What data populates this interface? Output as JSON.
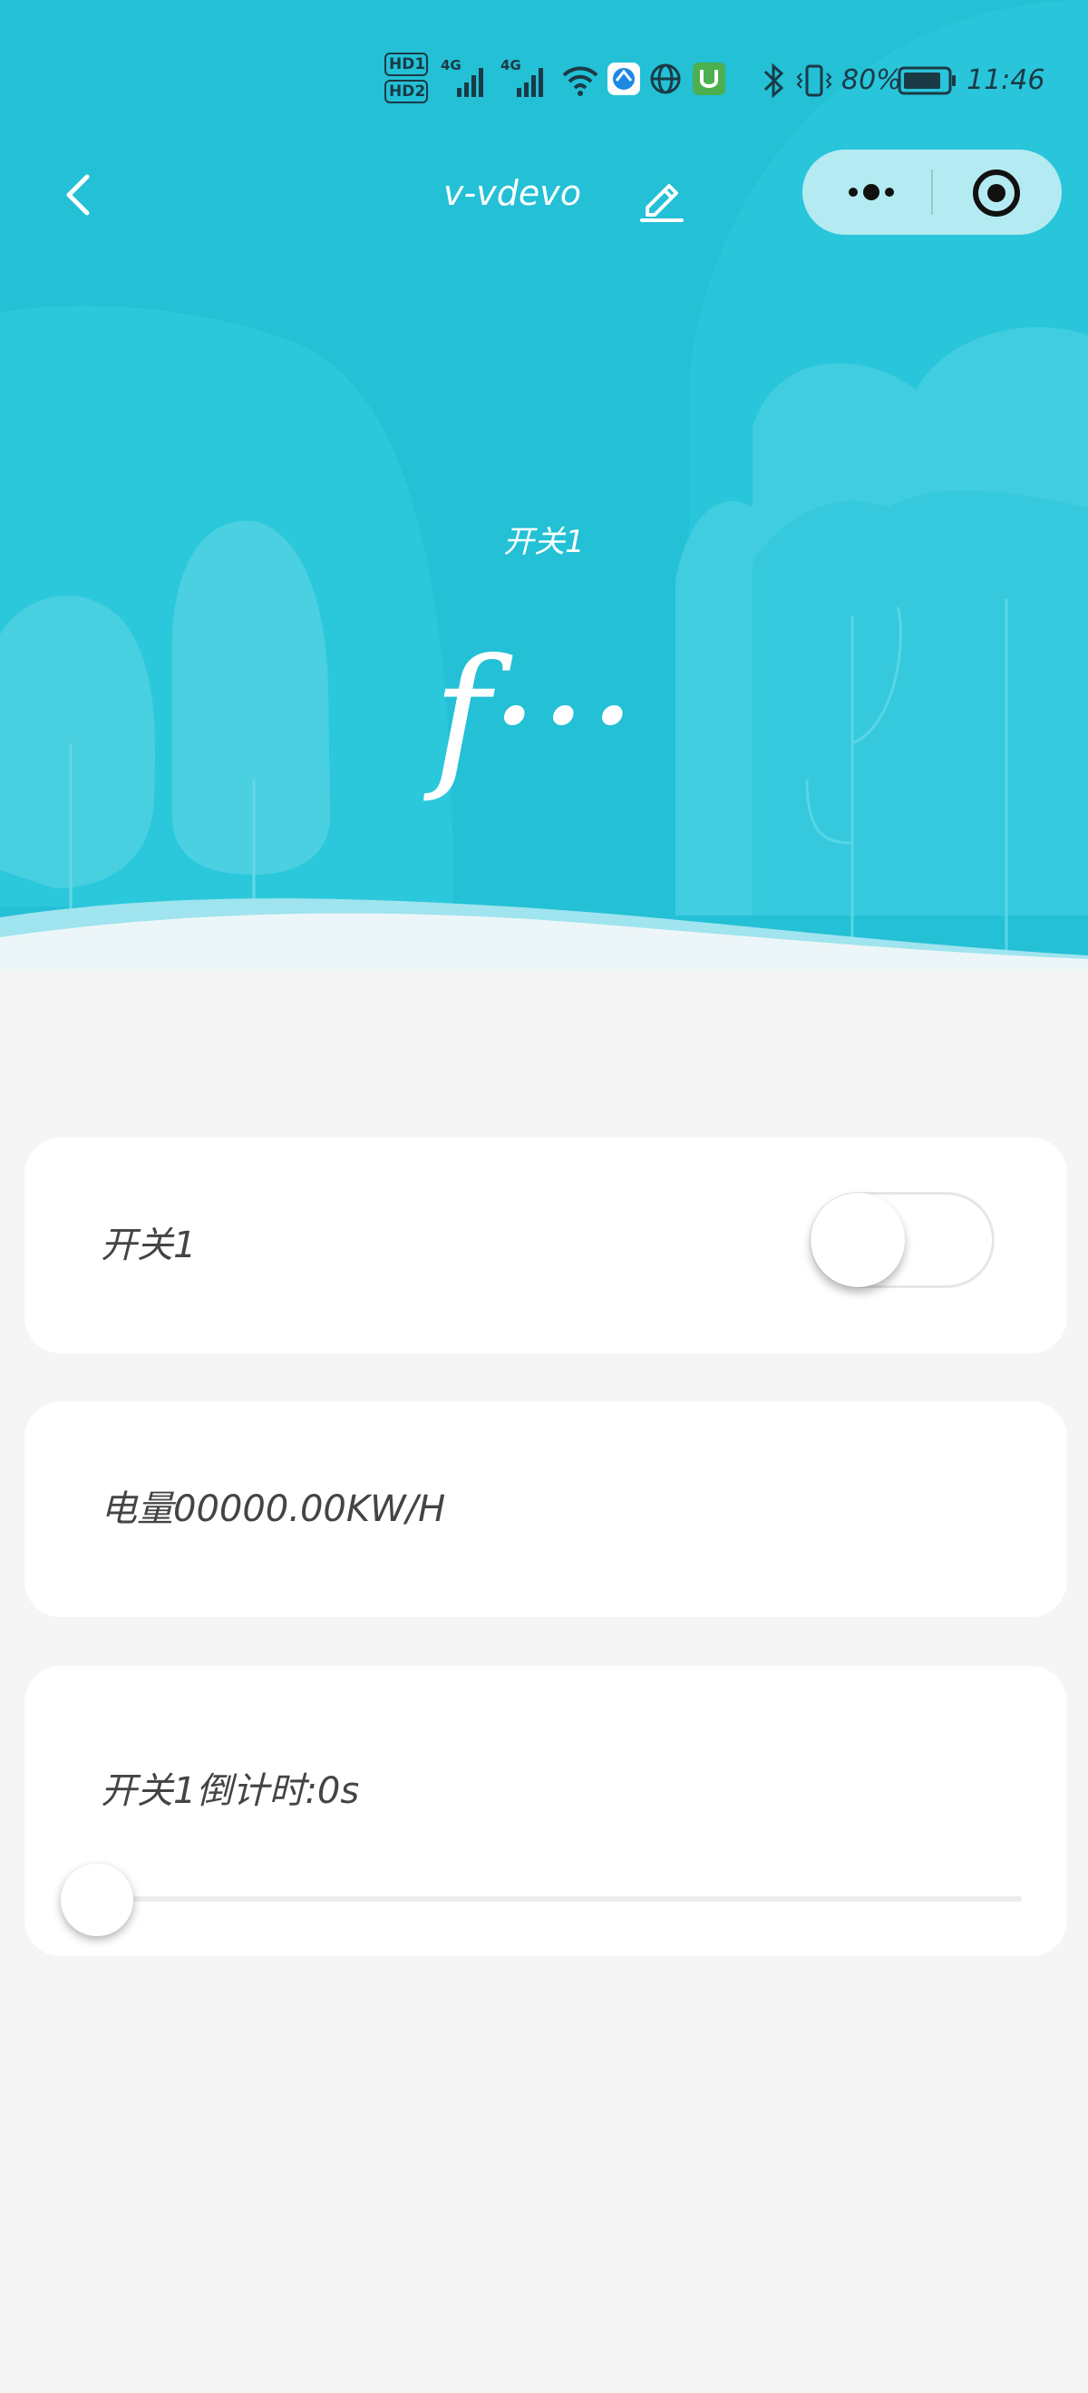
{
  "status_bar": {
    "hd1": "HD1",
    "hd2": "HD2",
    "net1": "4G",
    "net2": "4G",
    "battery_percent": "80%",
    "time": "11:46",
    "icons": [
      "wifi-icon",
      "browser-app-icon",
      "globe-icon",
      "app-icon",
      "bluetooth-icon",
      "vibrate-icon",
      "battery-icon"
    ]
  },
  "nav": {
    "title": "v-vdevo",
    "icons": [
      "back-icon",
      "edit-icon",
      "more-icon",
      "target-icon"
    ]
  },
  "hero": {
    "switch_name": "开关1",
    "switch_state": "f···"
  },
  "cards": {
    "switch_label": "开关1",
    "switch_on": false,
    "power_label": "电量00000.00KW/H",
    "countdown_label": "开关1倒计时:0s",
    "countdown_value": 0
  },
  "colors": {
    "primary": "#23c0d6",
    "background": "#f5f5f5",
    "card": "#ffffff"
  }
}
